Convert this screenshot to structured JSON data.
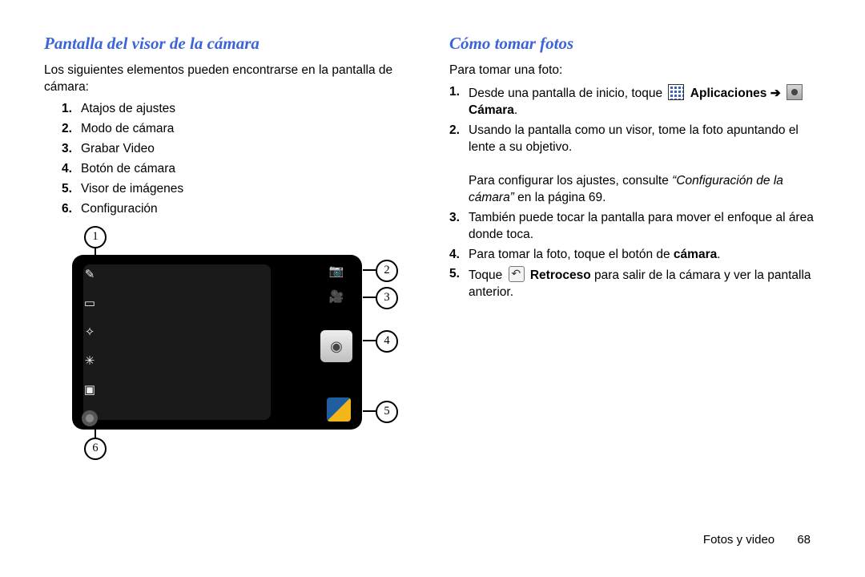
{
  "left": {
    "heading": "Pantalla del visor de la cámara",
    "intro": "Los siguientes elementos pueden encontrarse en la pantalla de cámara:",
    "items": [
      {
        "n": "1.",
        "t": "Atajos de ajustes"
      },
      {
        "n": "2.",
        "t": "Modo de cámara"
      },
      {
        "n": "3.",
        "t": "Grabar Video"
      },
      {
        "n": "4.",
        "t": "Botón de cámara"
      },
      {
        "n": "5.",
        "t": "Visor de imágenes"
      },
      {
        "n": "6.",
        "t": "Configuración"
      }
    ],
    "callouts": {
      "c1": "1",
      "c2": "2",
      "c3": "3",
      "c4": "4",
      "c5": "5",
      "c6": "6"
    }
  },
  "right": {
    "heading": "Cómo tomar fotos",
    "intro": "Para tomar una foto:",
    "steps": {
      "s1": {
        "n": "1.",
        "pre": "Desde una pantalla de inicio, toque ",
        "apps": "Aplicaciones",
        "arrow": " ➔ ",
        "cam": "Cámara",
        "post": "."
      },
      "s2": {
        "n": "2.",
        "t": "Usando la pantalla como un visor, tome la foto apuntando el lente a su objetivo.",
        "aux_pre": "Para configurar los ajustes, consulte ",
        "aux_link": "“Configuración de la cámara”",
        "aux_post": " en la página 69."
      },
      "s3": {
        "n": "3.",
        "t": "También puede tocar la pantalla para mover el enfoque al área donde toca."
      },
      "s4": {
        "n": "4.",
        "pre": "Para tomar la foto, toque el botón de ",
        "bold": "cámara",
        "post": "."
      },
      "s5": {
        "n": "5.",
        "pre": "Toque ",
        "back": "Retroceso",
        "post": " para salir de la cámara y ver la pantalla anterior."
      }
    }
  },
  "footer": {
    "section": "Fotos y video",
    "page": "68"
  }
}
